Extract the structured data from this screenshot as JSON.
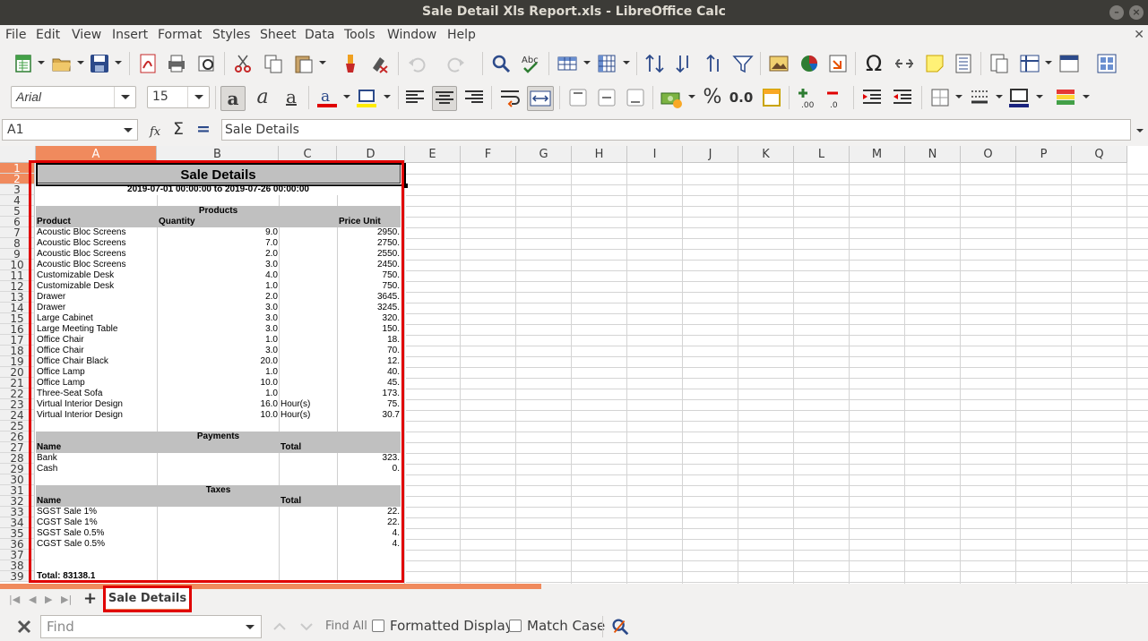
{
  "window": {
    "title": "Sale Detail Xls Report.xls - LibreOffice Calc"
  },
  "menu": [
    "File",
    "Edit",
    "View",
    "Insert",
    "Format",
    "Styles",
    "Sheet",
    "Data",
    "Tools",
    "Window",
    "Help"
  ],
  "toolbar": {
    "font_name": "Arial",
    "font_size": "15",
    "percent_label": "%",
    "decimal_label": "0.0",
    "omega_label": "Ω"
  },
  "formula": {
    "cell_ref": "A1",
    "content": "Sale Details",
    "sum_symbol": "Σ",
    "equals_symbol": "="
  },
  "columns": [
    "A",
    "B",
    "C",
    "D",
    "E",
    "F",
    "G",
    "H",
    "I",
    "J",
    "K",
    "L",
    "M",
    "N",
    "O",
    "P",
    "Q"
  ],
  "rows": [
    "1",
    "2",
    "3",
    "4",
    "5",
    "6",
    "7",
    "8",
    "9",
    "10",
    "11",
    "12",
    "13",
    "14",
    "15",
    "16",
    "17",
    "18",
    "19",
    "20",
    "21",
    "22",
    "23",
    "24",
    "25",
    "26",
    "27",
    "28",
    "29",
    "30",
    "31",
    "32",
    "33",
    "34",
    "35",
    "36",
    "37",
    "38",
    "39"
  ],
  "report": {
    "title": "Sale Details",
    "date_range": "2019-07-01 00:00:00 to 2019-07-26 00:00:00",
    "products_header": "Products",
    "product_columns": {
      "product": "Product",
      "quantity": "Quantity",
      "price_unit": "Price Unit"
    },
    "products": [
      {
        "name": "Acoustic Bloc Screens",
        "qty": "9.0",
        "unit": "",
        "price": "2950."
      },
      {
        "name": "Acoustic Bloc Screens",
        "qty": "7.0",
        "unit": "",
        "price": "2750."
      },
      {
        "name": "Acoustic Bloc Screens",
        "qty": "2.0",
        "unit": "",
        "price": "2550."
      },
      {
        "name": "Acoustic Bloc Screens",
        "qty": "3.0",
        "unit": "",
        "price": "2450."
      },
      {
        "name": "Customizable Desk",
        "qty": "4.0",
        "unit": "",
        "price": "750."
      },
      {
        "name": "Customizable Desk",
        "qty": "1.0",
        "unit": "",
        "price": "750."
      },
      {
        "name": "Drawer",
        "qty": "2.0",
        "unit": "",
        "price": "3645."
      },
      {
        "name": "Drawer",
        "qty": "3.0",
        "unit": "",
        "price": "3245."
      },
      {
        "name": "Large Cabinet",
        "qty": "3.0",
        "unit": "",
        "price": "320."
      },
      {
        "name": "Large Meeting Table",
        "qty": "3.0",
        "unit": "",
        "price": "150."
      },
      {
        "name": "Office Chair",
        "qty": "1.0",
        "unit": "",
        "price": "18."
      },
      {
        "name": "Office Chair",
        "qty": "3.0",
        "unit": "",
        "price": "70."
      },
      {
        "name": "Office Chair Black",
        "qty": "20.0",
        "unit": "",
        "price": "12."
      },
      {
        "name": "Office Lamp",
        "qty": "1.0",
        "unit": "",
        "price": "40."
      },
      {
        "name": "Office Lamp",
        "qty": "10.0",
        "unit": "",
        "price": "45."
      },
      {
        "name": "Three-Seat Sofa",
        "qty": "1.0",
        "unit": "",
        "price": "173."
      },
      {
        "name": "Virtual Interior Design",
        "qty": "16.0",
        "unit": "Hour(s)",
        "price": "75."
      },
      {
        "name": "Virtual Interior Design",
        "qty": "10.0",
        "unit": "Hour(s)",
        "price": "30.7"
      }
    ],
    "payments_header": "Payments",
    "payment_columns": {
      "name": "Name",
      "total": "Total"
    },
    "payments": [
      {
        "name": "Bank",
        "total": "323."
      },
      {
        "name": "Cash",
        "total": "0."
      }
    ],
    "taxes_header": "Taxes",
    "tax_columns": {
      "name": "Name",
      "total": "Total"
    },
    "taxes": [
      {
        "name": "SGST Sale 1%",
        "total": "22."
      },
      {
        "name": "CGST Sale 1%",
        "total": "22."
      },
      {
        "name": "SGST Sale 0.5%",
        "total": "4."
      },
      {
        "name": "CGST Sale 0.5%",
        "total": "4."
      }
    ],
    "total_line": "Total:  83138.1"
  },
  "sheet_tab": {
    "name": "Sale Details"
  },
  "findbar": {
    "placeholder": "Find",
    "find_all": "Find All",
    "formatted_display": "Formatted Display",
    "match_case": "Match Case"
  },
  "colors": {
    "accent": "#f08a5d",
    "highlight_red": "#e00000",
    "band_gray": "#c0c0c0"
  }
}
